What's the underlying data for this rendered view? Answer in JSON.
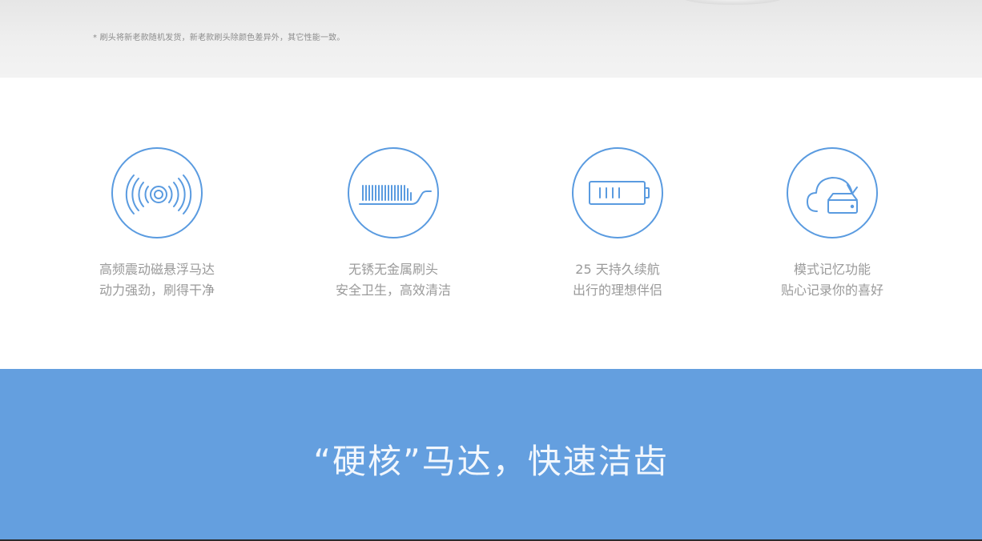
{
  "footnote": "* 刷头将新老款随机发货，新老款刷头除颜色差异外，其它性能一致。",
  "features": [
    {
      "icon": "vibration-icon",
      "line1": "高频震动磁悬浮马达",
      "line2": "动力强劲，刷得干净"
    },
    {
      "icon": "brush-head-icon",
      "line1": "无锈无金属刷头",
      "line2": "安全卫生，高效清洁"
    },
    {
      "icon": "battery-icon",
      "line1": "25 天持久续航",
      "line2": "出行的理想伴侣"
    },
    {
      "icon": "cloud-memory-icon",
      "line1": "模式记忆功能",
      "line2": "贴心记录你的喜好"
    }
  ],
  "banner": {
    "headline": "“硬核”马达，快速洁齿"
  },
  "colors": {
    "accent": "#5a9be0",
    "banner_bg": "#649fdf",
    "caption_text": "#9a9a9a"
  }
}
